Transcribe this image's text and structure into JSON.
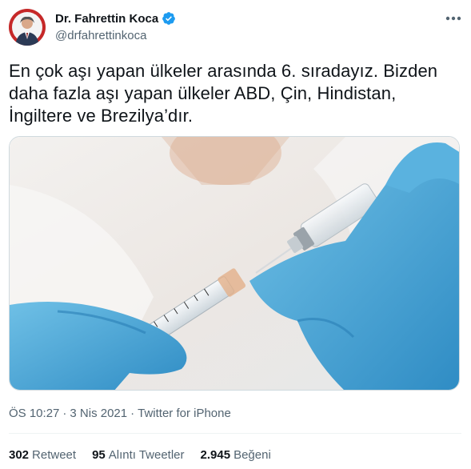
{
  "author": {
    "display_name": "Dr. Fahrettin Koca",
    "handle": "@drfahrettinkoca",
    "verified": true
  },
  "tweet": {
    "text": "En çok aşı yapan ülkeler arasında 6. sıradayız. Bizden daha fazla aşı yapan ülkeler ABD, Çin, Hindistan, İngiltere ve Brezilya’dır.",
    "time": "ÖS 10:27",
    "date": "3 Nis 2021",
    "source": "Twitter for iPhone"
  },
  "stats": {
    "retweets": {
      "count": "302",
      "label": "Retweet"
    },
    "quotes": {
      "count": "95",
      "label": "Alıntı Tweetler"
    },
    "likes": {
      "count": "2.945",
      "label": "Beğeni"
    }
  },
  "icons": {
    "verified": "verified-badge-icon",
    "more": "more-options-icon"
  },
  "colors": {
    "verified_blue": "#1d9bf0",
    "secondary_text": "#536471",
    "primary_text": "#0f1419",
    "glove_blue": "#4aa6d6"
  }
}
